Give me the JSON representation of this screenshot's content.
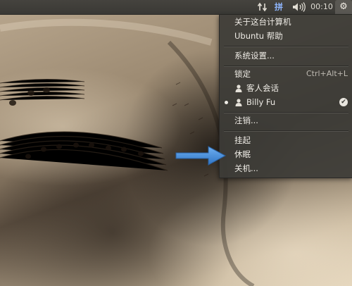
{
  "panel": {
    "network_icon": "network-updown-icon",
    "input_method": "拼",
    "sound_icon": "volume-icon",
    "clock": "00:10",
    "session_icon": "gear-icon"
  },
  "menu": {
    "about": "关于这台计算机",
    "help": "Ubuntu 帮助",
    "settings": "系统设置...",
    "lock": "锁定",
    "lock_shortcut": "Ctrl+Alt+L",
    "guest": "客人会话",
    "user": "Billy Fu",
    "logout": "注销...",
    "suspend": "挂起",
    "hibernate": "休眠",
    "shutdown": "关机..."
  },
  "colors": {
    "panel_bg": "#3c3b37",
    "menu_bg": "#3c3b37",
    "menu_text": "#eeebe5",
    "input_method_accent": "#8fb6ff",
    "arrow": "#3d86d6"
  }
}
